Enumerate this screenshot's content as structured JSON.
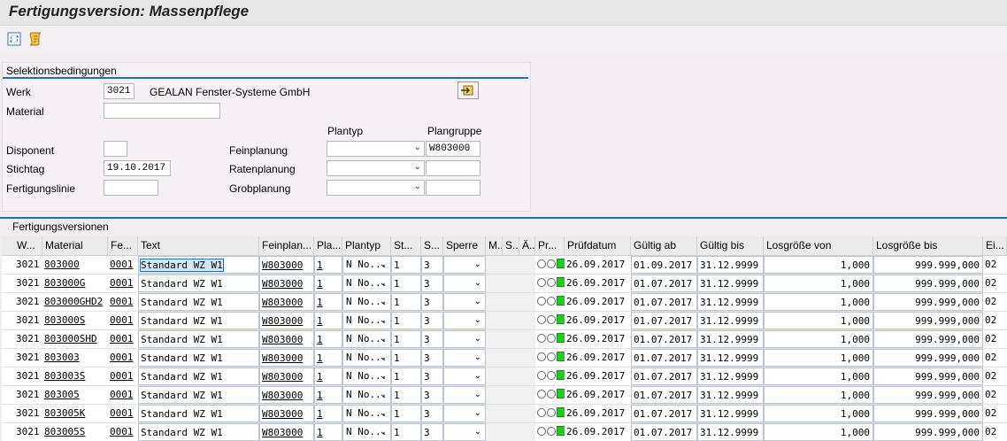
{
  "window": {
    "title": "Fertigungsversion: Massenpflege"
  },
  "toolbar": {
    "icons": [
      "refresh-icon",
      "scroll-icon"
    ]
  },
  "selection": {
    "title": "Selektionsbedingungen",
    "werk_label": "Werk",
    "werk_value": "3021",
    "werk_desc": "GEALAN Fenster-Systeme GmbH",
    "material_label": "Material",
    "material_value": "",
    "disponent_label": "Disponent",
    "disponent_value": "",
    "stichtag_label": "Stichtag",
    "stichtag_value": "19.10.2017",
    "fertigungslinie_label": "Fertigungslinie",
    "fertigungslinie_value": "",
    "plantyp_header": "Plantyp",
    "plangruppe_header": "Plangruppe",
    "feinplanung_label": "Feinplanung",
    "feinplanung_plantyp": "",
    "feinplanung_plangruppe": "W803000",
    "ratenplanung_label": "Ratenplanung",
    "ratenplanung_plantyp": "",
    "ratenplanung_plangruppe": "",
    "grobplanung_label": "Grobplanung",
    "grobplanung_plantyp": "",
    "grobplanung_plangruppe": ""
  },
  "grid": {
    "title": "Fertigungsversionen",
    "headers": [
      "W...",
      "Material",
      "Fe...",
      "Text",
      "Feinplan...",
      "Pla...",
      "Plantyp",
      "St...",
      "S...",
      "Sperre",
      "M..",
      "S..",
      "Ä..",
      "Pr...",
      "Prüfdatum",
      "Gültig ab",
      "Gültig bis",
      "Losgröße von",
      "Losgröße bis",
      "Ei..."
    ],
    "rows": [
      {
        "werk": "3021",
        "material": "803000",
        "fv": "0001",
        "text": "Standard WZ W1",
        "feinplan": "W803000",
        "pla": "1",
        "plantyp": "N No...",
        "st": "1",
        "s": "3",
        "pruef": "26.09.2017",
        "ab": "01.09.2017",
        "bis": "31.12.9999",
        "von": "1,000",
        "losbis": "999.999,000",
        "ei": "02"
      },
      {
        "werk": "3021",
        "material": "803000G",
        "fv": "0001",
        "text": "Standard WZ W1",
        "feinplan": "W803000",
        "pla": "1",
        "plantyp": "N No...",
        "st": "1",
        "s": "3",
        "pruef": "26.09.2017",
        "ab": "01.07.2017",
        "bis": "31.12.9999",
        "von": "1,000",
        "losbis": "999.999,000",
        "ei": "02"
      },
      {
        "werk": "3021",
        "material": "803000GHD2",
        "fv": "0001",
        "text": "Standard WZ W1",
        "feinplan": "W803000",
        "pla": "1",
        "plantyp": "N No...",
        "st": "1",
        "s": "3",
        "pruef": "26.09.2017",
        "ab": "01.07.2017",
        "bis": "31.12.9999",
        "von": "1,000",
        "losbis": "999.999,000",
        "ei": "02"
      },
      {
        "werk": "3021",
        "material": "803000S",
        "fv": "0001",
        "text": "Standard WZ W1",
        "feinplan": "W803000",
        "pla": "1",
        "plantyp": "N No...",
        "st": "1",
        "s": "3",
        "pruef": "26.09.2017",
        "ab": "01.07.2017",
        "bis": "31.12.9999",
        "von": "1,000",
        "losbis": "999.999,000",
        "ei": "02"
      },
      {
        "werk": "3021",
        "material": "803000SHD",
        "fv": "0001",
        "text": "Standard WZ W1",
        "feinplan": "W803000",
        "pla": "1",
        "plantyp": "N No...",
        "st": "1",
        "s": "3",
        "pruef": "26.09.2017",
        "ab": "01.07.2017",
        "bis": "31.12.9999",
        "von": "1,000",
        "losbis": "999.999,000",
        "ei": "02"
      },
      {
        "werk": "3021",
        "material": "803003",
        "fv": "0001",
        "text": "Standard WZ W1",
        "feinplan": "W803000",
        "pla": "1",
        "plantyp": "N No...",
        "st": "1",
        "s": "3",
        "pruef": "26.09.2017",
        "ab": "01.07.2017",
        "bis": "31.12.9999",
        "von": "1,000",
        "losbis": "999.999,000",
        "ei": "02"
      },
      {
        "werk": "3021",
        "material": "803003S",
        "fv": "0001",
        "text": "Standard WZ W1",
        "feinplan": "W803000",
        "pla": "1",
        "plantyp": "N No...",
        "st": "1",
        "s": "3",
        "pruef": "26.09.2017",
        "ab": "01.07.2017",
        "bis": "31.12.9999",
        "von": "1,000",
        "losbis": "999.999,000",
        "ei": "02"
      },
      {
        "werk": "3021",
        "material": "803005",
        "fv": "0001",
        "text": "Standard WZ W1",
        "feinplan": "W803000",
        "pla": "1",
        "plantyp": "N No...",
        "st": "1",
        "s": "3",
        "pruef": "26.09.2017",
        "ab": "01.07.2017",
        "bis": "31.12.9999",
        "von": "1,000",
        "losbis": "999.999,000",
        "ei": "02"
      },
      {
        "werk": "3021",
        "material": "803005K",
        "fv": "0001",
        "text": "Standard WZ W1",
        "feinplan": "W803000",
        "pla": "1",
        "plantyp": "N No...",
        "st": "1",
        "s": "3",
        "pruef": "26.09.2017",
        "ab": "01.07.2017",
        "bis": "31.12.9999",
        "von": "1,000",
        "losbis": "999.999,000",
        "ei": "02"
      },
      {
        "werk": "3021",
        "material": "803005S",
        "fv": "0001",
        "text": "Standard WZ W1",
        "feinplan": "W803000",
        "pla": "1",
        "plantyp": "N No...",
        "st": "1",
        "s": "3",
        "pruef": "26.09.2017",
        "ab": "01.07.2017",
        "bis": "31.12.9999",
        "von": "1,000",
        "losbis": "999.999,000",
        "ei": "02"
      }
    ]
  }
}
